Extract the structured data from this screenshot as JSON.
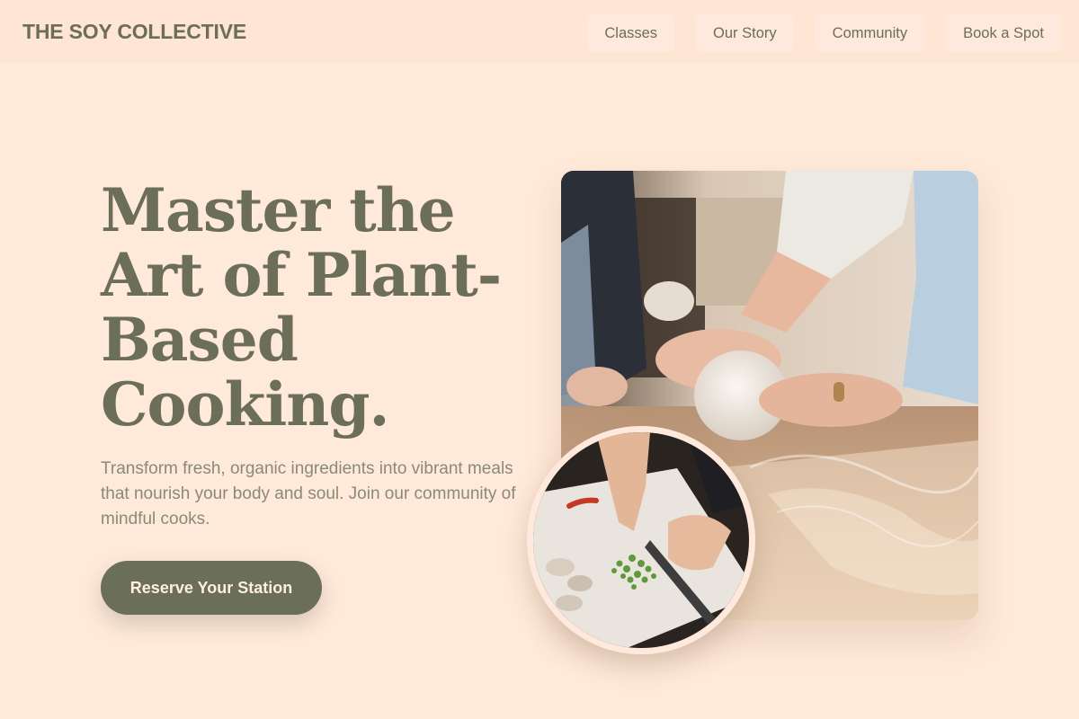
{
  "header": {
    "brand": "THE SOY COLLECTIVE",
    "nav": [
      "Classes",
      "Our Story",
      "Community",
      "Book a Spot"
    ]
  },
  "hero": {
    "title": "Master the Art of Plant-Based Cooking.",
    "subtitle": "Transform fresh, organic ingredients into vibrant meals that nourish your body and soul. Join our community of mindful cooks.",
    "cta_label": "Reserve Your Station"
  },
  "images": {
    "main": "hands-kneading-dough-photo",
    "inset": "chopping-green-onions-photo"
  },
  "colors": {
    "background": "#ffe9d9",
    "accent": "#6b6e58",
    "muted_text": "#8a8a7a"
  }
}
